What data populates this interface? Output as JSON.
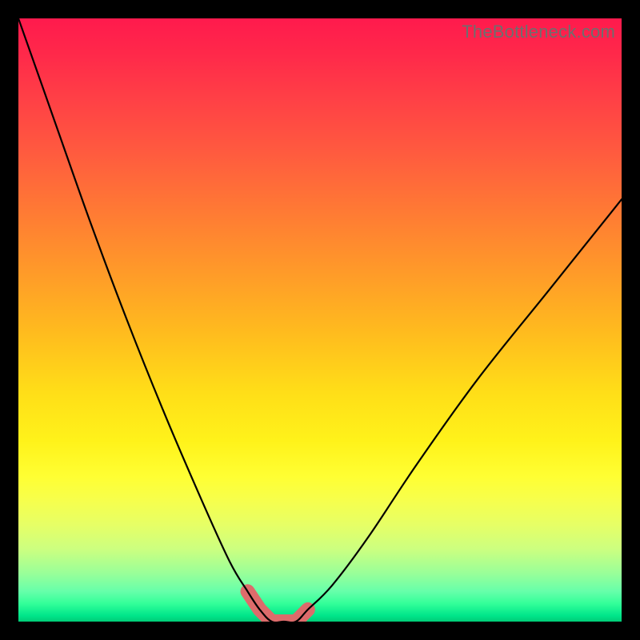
{
  "watermark": "TheBottleneck.com",
  "colors": {
    "background": "#000000",
    "curve_stroke": "#000000",
    "valley_marker": "#dd6b6b",
    "watermark_text": "#6e6e6e"
  },
  "chart_data": {
    "type": "line",
    "title": "",
    "xlabel": "",
    "ylabel": "",
    "xlim": [
      0,
      100
    ],
    "ylim": [
      0,
      100
    ],
    "grid": false,
    "legend": false,
    "series": [
      {
        "name": "bottleneck_curve",
        "x": [
          0,
          6,
          12,
          18,
          24,
          30,
          35,
          38,
          40,
          42,
          44,
          46,
          48,
          52,
          58,
          66,
          76,
          88,
          100
        ],
        "values": [
          100,
          83,
          66,
          50,
          35,
          21,
          10,
          5,
          2,
          0,
          0,
          0,
          2,
          6,
          14,
          26,
          40,
          55,
          70
        ]
      }
    ],
    "annotations": [
      {
        "name": "optimal_valley_marker",
        "kind": "polyline_marker",
        "x": [
          38,
          40,
          42,
          44,
          46,
          48
        ],
        "values": [
          5,
          2,
          0,
          0,
          0,
          2
        ]
      }
    ]
  }
}
